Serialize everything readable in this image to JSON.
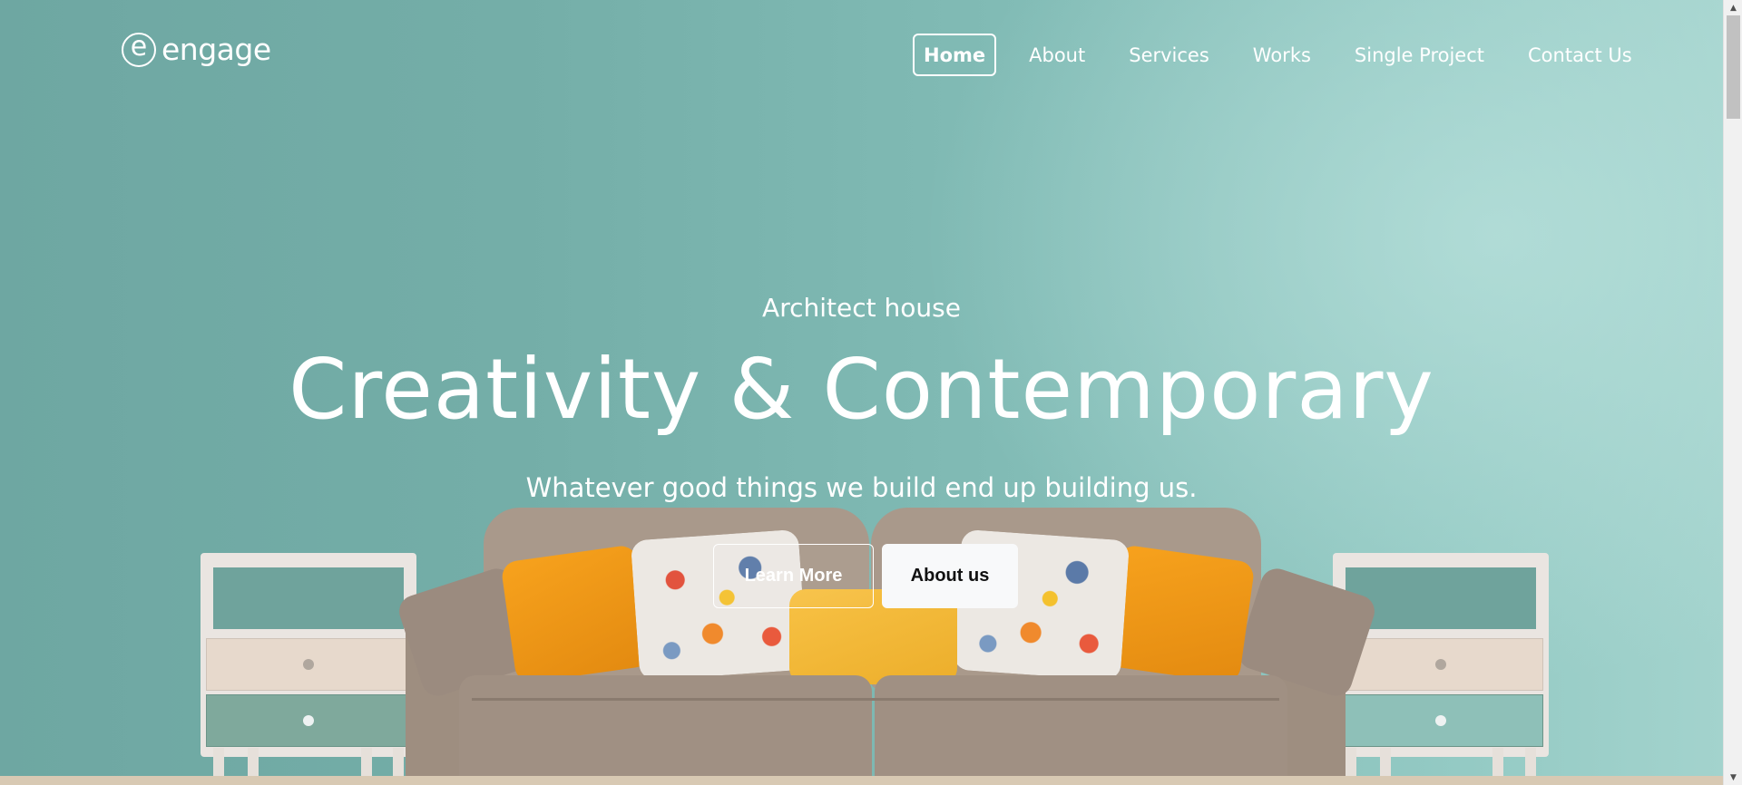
{
  "brand": {
    "logo_letter": "e",
    "name": "engage"
  },
  "nav": {
    "items": [
      {
        "label": "Home",
        "active": true
      },
      {
        "label": "About"
      },
      {
        "label": "Services"
      },
      {
        "label": "Works"
      },
      {
        "label": "Single Project"
      },
      {
        "label": "Contact Us"
      }
    ]
  },
  "hero": {
    "eyebrow": "Architect house",
    "headline": "Creativity & Contemporary",
    "subline": "Whatever good things we build end up building us.",
    "primary_button": "Learn More",
    "secondary_button": "About us"
  },
  "colors": {
    "wall": "#7fb8b1",
    "sofa": "#a9998b",
    "pillow_orange": "#f7a21d",
    "pillow_yellow": "#f8c245",
    "text": "#ffffff"
  },
  "icons": {
    "scroll_up": "scroll-up-arrow-icon",
    "scroll_down": "scroll-down-arrow-icon"
  }
}
